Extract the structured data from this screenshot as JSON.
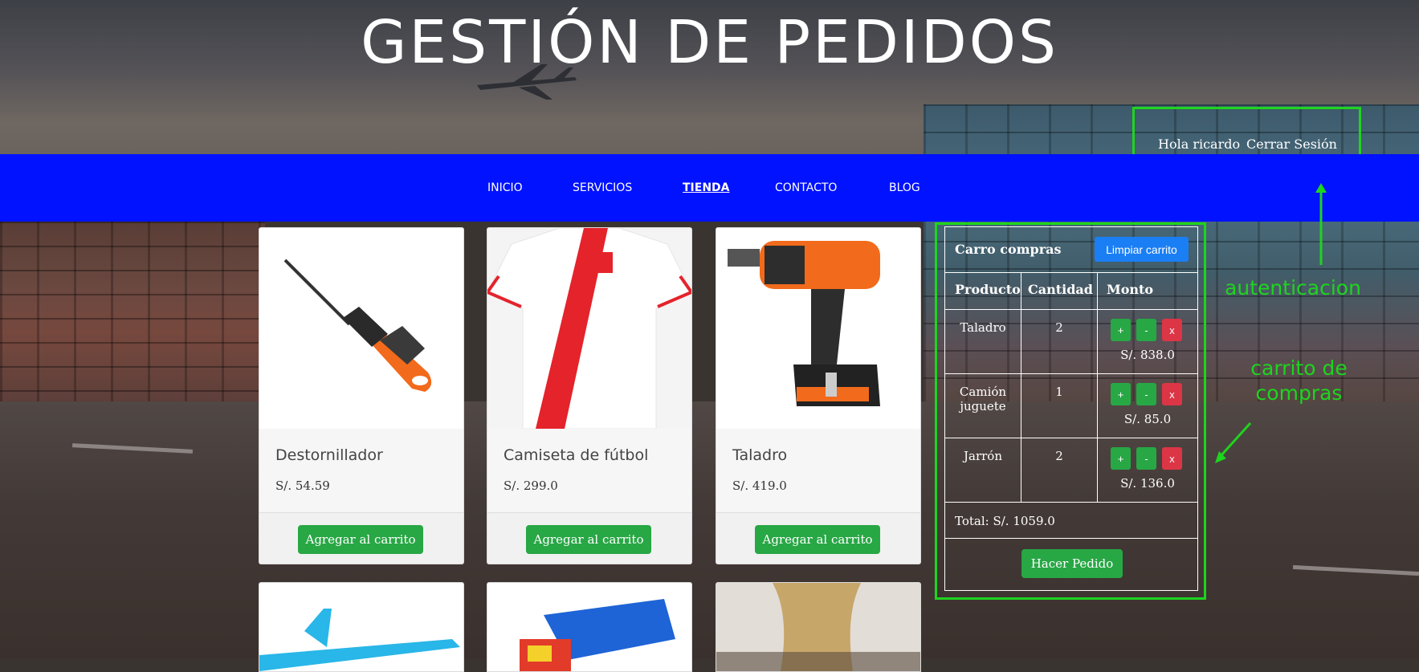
{
  "header": {
    "title": "GESTIÓN DE PEDIDOS"
  },
  "auth": {
    "greeting": "Hola ricardo",
    "logout": "Cerrar Sesión"
  },
  "nav": {
    "items": [
      {
        "label": "INICIO"
      },
      {
        "label": "SERVICIOS"
      },
      {
        "label": "TIENDA"
      },
      {
        "label": "CONTACTO"
      },
      {
        "label": "BLOG"
      }
    ],
    "active": "TIENDA"
  },
  "products": [
    {
      "name": "Destornillador",
      "price": "S/. 54.59",
      "button": "Agregar al carrito"
    },
    {
      "name": "Camiseta de fútbol",
      "price": "S/. 299.0",
      "button": "Agregar al carrito"
    },
    {
      "name": "Taladro",
      "price": "S/. 419.0",
      "button": "Agregar al carrito"
    }
  ],
  "cart": {
    "title": "Carro compras",
    "clear_button": "Limpiar carrito",
    "headers": [
      "Producto",
      "Cantidad",
      "Monto"
    ],
    "items": [
      {
        "product": "Taladro",
        "quantity": "2",
        "amount": "S/. 838.0"
      },
      {
        "product": "Camión juguete",
        "quantity": "1",
        "amount": "S/. 85.0"
      },
      {
        "product": "Jarrón",
        "quantity": "2",
        "amount": "S/. 136.0"
      }
    ],
    "plus": "+",
    "minus": "-",
    "remove": "x",
    "total": "Total: S/. 1059.0",
    "order_button": "Hacer Pedido"
  },
  "annotations": {
    "auth_label": "autenticacion",
    "cart_label": "carrito de compras"
  },
  "colors": {
    "navbar": "#0012ff",
    "annotation": "#1ed41e",
    "button_green": "#28a745",
    "button_blue": "#1a7ef5",
    "button_red": "#dc3545"
  },
  "icons": [
    "airplane-icon",
    "screwdriver-image",
    "football-shirt-image",
    "drill-image",
    "toy-airplane-image",
    "toy-truck-image",
    "vase-image",
    "arrow-annotation-icon"
  ]
}
